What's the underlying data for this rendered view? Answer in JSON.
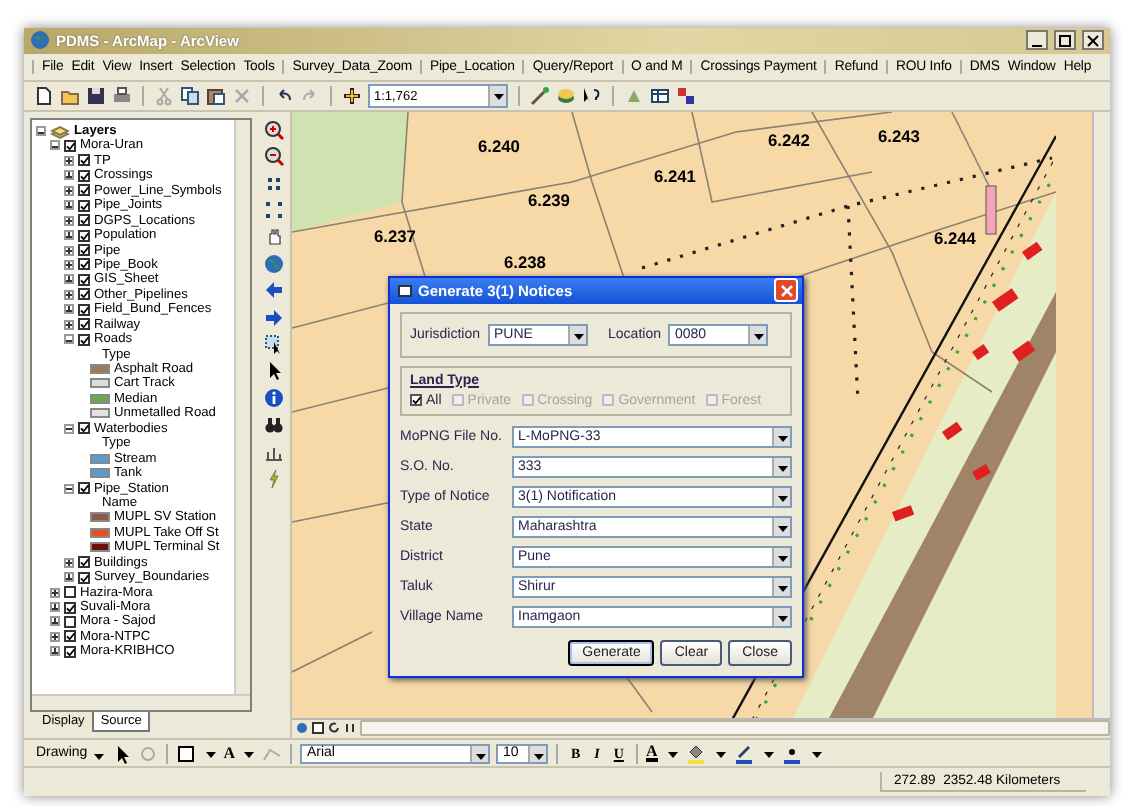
{
  "window": {
    "title": "PDMS - ArcMap - ArcView"
  },
  "menus": [
    [
      "File",
      "Edit",
      "View",
      "Insert",
      "Selection",
      "Tools"
    ],
    [
      "Survey_Data_Zoom"
    ],
    [
      "Pipe_Location"
    ],
    [
      "Query/Report"
    ],
    [
      "O and M"
    ],
    [
      "Crossings Payment"
    ],
    [
      "Refund"
    ],
    [
      "ROU Info"
    ],
    [
      "DMS",
      "Window",
      "Help"
    ]
  ],
  "toolbar": {
    "scale": "1:1,762"
  },
  "toc": {
    "tree": [
      {
        "kind": "group",
        "label": "Layers",
        "expanded": true,
        "children": [
          {
            "kind": "layer",
            "label": "Mora-Uran",
            "checked": true,
            "expanded": true,
            "children": [
              {
                "kind": "layer",
                "label": "TP",
                "checked": true,
                "expanded": false
              },
              {
                "kind": "layer",
                "label": "Crossings",
                "checked": true,
                "expanded": false
              },
              {
                "kind": "layer",
                "label": "Power_Line_Symbols",
                "checked": true,
                "expanded": false
              },
              {
                "kind": "layer",
                "label": "Pipe_Joints",
                "checked": true,
                "expanded": false
              },
              {
                "kind": "layer",
                "label": "DGPS_Locations",
                "checked": true,
                "expanded": false
              },
              {
                "kind": "layer",
                "label": "Population",
                "checked": true,
                "expanded": false
              },
              {
                "kind": "layer",
                "label": "Pipe",
                "checked": true,
                "expanded": false
              },
              {
                "kind": "layer",
                "label": "Pipe_Book",
                "checked": true,
                "expanded": false
              },
              {
                "kind": "layer",
                "label": "GIS_Sheet",
                "checked": true,
                "expanded": false
              },
              {
                "kind": "layer",
                "label": "Other_Pipelines",
                "checked": true,
                "expanded": false
              },
              {
                "kind": "layer",
                "label": "Field_Bund_Fences",
                "checked": true,
                "expanded": false
              },
              {
                "kind": "layer",
                "label": "Railway",
                "checked": true,
                "expanded": false
              },
              {
                "kind": "layer",
                "label": "Roads",
                "checked": true,
                "expanded": true,
                "children": [
                  {
                    "kind": "heading",
                    "label": "Type"
                  },
                  {
                    "kind": "legend",
                    "label": "Asphalt Road",
                    "color": "#9c7a5a"
                  },
                  {
                    "kind": "legend",
                    "label": "Cart Track",
                    "color": "#dcdcdc"
                  },
                  {
                    "kind": "legend",
                    "label": "Median",
                    "color": "#6aa84f"
                  },
                  {
                    "kind": "legend",
                    "label": "Unmetalled Road",
                    "color": "#e4e0e0"
                  }
                ]
              },
              {
                "kind": "layer",
                "label": "Waterbodies",
                "checked": true,
                "expanded": true,
                "children": [
                  {
                    "kind": "heading",
                    "label": "Type"
                  },
                  {
                    "kind": "legend",
                    "label": "Stream",
                    "color": "#5b9bd5"
                  },
                  {
                    "kind": "legend",
                    "label": "Tank",
                    "color": "#5b9bd5"
                  }
                ]
              },
              {
                "kind": "layer",
                "label": "Pipe_Station",
                "checked": true,
                "expanded": true,
                "children": [
                  {
                    "kind": "heading",
                    "label": "Name"
                  },
                  {
                    "kind": "legend",
                    "label": "MUPL SV Station",
                    "color": "#8b5a4a"
                  },
                  {
                    "kind": "legend",
                    "label": "MUPL Take Off St",
                    "color": "#e8501e"
                  },
                  {
                    "kind": "legend",
                    "label": "MUPL Terminal St",
                    "color": "#6b0f0f"
                  }
                ]
              },
              {
                "kind": "layer",
                "label": "Buildings",
                "checked": true,
                "expanded": false
              },
              {
                "kind": "layer",
                "label": "Survey_Boundaries",
                "checked": true,
                "expanded": false
              }
            ]
          },
          {
            "kind": "layer",
            "label": "Hazira-Mora",
            "checked": false,
            "expanded": false
          },
          {
            "kind": "layer",
            "label": "Suvali-Mora",
            "checked": true,
            "expanded": false
          },
          {
            "kind": "layer",
            "label": "Mora - Sajod",
            "checked": false,
            "expanded": false
          },
          {
            "kind": "layer",
            "label": "Mora-NTPC",
            "checked": true,
            "expanded": false
          },
          {
            "kind": "layer",
            "label": "Mora-KRIBHCO",
            "checked": true,
            "expanded": false
          }
        ]
      }
    ],
    "tabs": [
      {
        "label": "Display",
        "selected": false
      },
      {
        "label": "Source",
        "selected": true
      }
    ]
  },
  "map": {
    "labels": [
      {
        "text": "6.240"
      },
      {
        "text": "6.241"
      },
      {
        "text": "6.242"
      },
      {
        "text": "6.243"
      },
      {
        "text": "6.239"
      },
      {
        "text": "6.237"
      },
      {
        "text": "6.238"
      },
      {
        "text": "6.244"
      }
    ]
  },
  "dialog": {
    "title": "Generate 3(1) Notices",
    "header_fields": [
      {
        "label": "Jurisdiction",
        "value": "PUNE"
      },
      {
        "label": "Location",
        "value": "0080"
      }
    ],
    "land_type": {
      "label": "Land Type",
      "options": [
        {
          "label": "All",
          "checked": true,
          "disabled": false
        },
        {
          "label": "Private",
          "checked": false,
          "disabled": true
        },
        {
          "label": "Crossing",
          "checked": false,
          "disabled": true
        },
        {
          "label": "Government",
          "checked": false,
          "disabled": true
        },
        {
          "label": "Forest",
          "checked": false,
          "disabled": true
        }
      ]
    },
    "fields": [
      {
        "label": "MoPNG File No.",
        "value": "L-MoPNG-33"
      },
      {
        "label": "S.O. No.",
        "value": "333"
      },
      {
        "label": "Type of Notice",
        "value": "3(1) Notification"
      },
      {
        "label": "State",
        "value": "Maharashtra"
      },
      {
        "label": "District",
        "value": "Pune"
      },
      {
        "label": "Taluk",
        "value": "Shirur"
      },
      {
        "label": "Village Name",
        "value": "Inamgaon"
      }
    ],
    "buttons": [
      {
        "label": "Generate",
        "default": true
      },
      {
        "label": "Clear",
        "default": false
      },
      {
        "label": "Close",
        "default": false
      }
    ]
  },
  "drawing_toolbar": {
    "menu": "Drawing",
    "text_tool": "A",
    "font": "Arial",
    "size": "10",
    "format_buttons": [
      "B",
      "I",
      "U"
    ],
    "font_color": "A"
  },
  "status_bar": {
    "coordinates": "272.89  2352.48 Kilometers"
  }
}
